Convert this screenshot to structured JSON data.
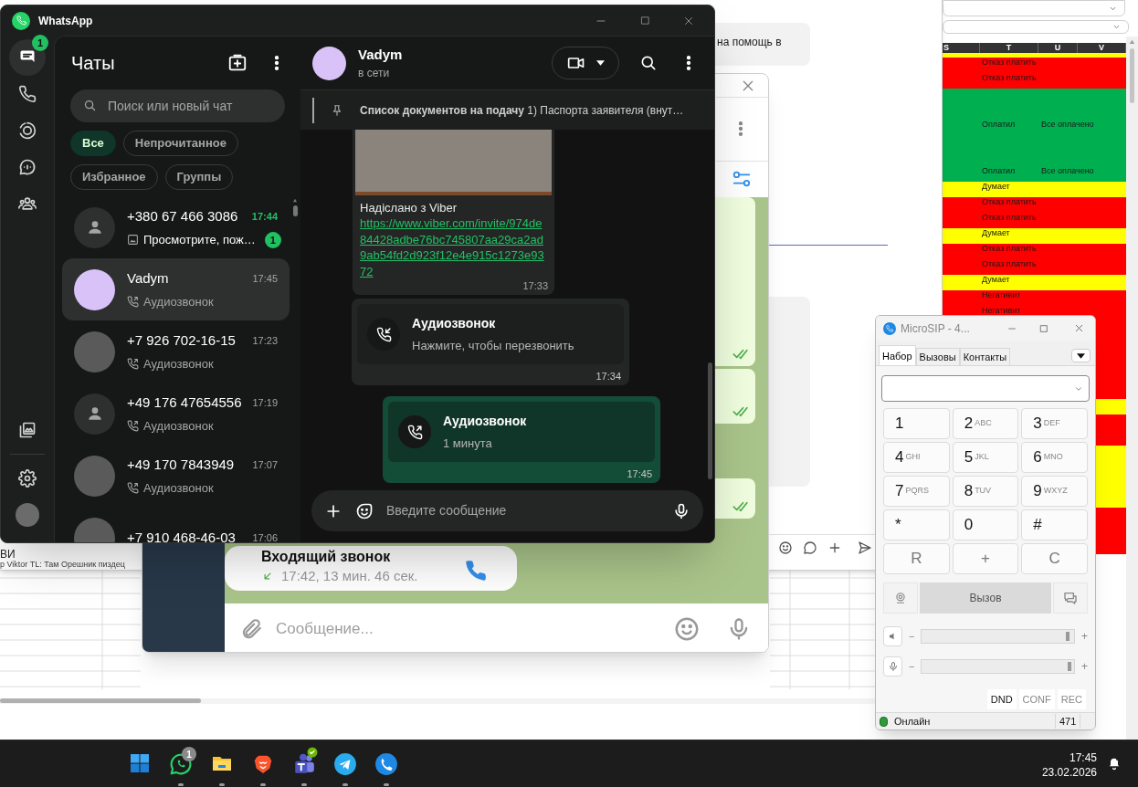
{
  "spreadsheet": {
    "columns": [
      "S",
      "T",
      "U",
      "V"
    ],
    "rows": [
      {
        "kind": "partial",
        "color": "#ffff00"
      },
      {
        "kind": "normal",
        "color": "#ff0000",
        "t": "Отказ платить"
      },
      {
        "kind": "normal",
        "color": "#ff0000",
        "t": "Отказ платить"
      },
      {
        "kind": "tall",
        "color": "#00b050",
        "t": "Оплатил",
        "u": "Все оплачено"
      },
      {
        "kind": "tall",
        "color": "#00b050",
        "t": "Оплатил",
        "u": "Все оплачено"
      },
      {
        "kind": "normal",
        "color": "#ffff00",
        "t": "Думает"
      },
      {
        "kind": "normal",
        "color": "#ff0000",
        "t": "Отказ платить"
      },
      {
        "kind": "normal",
        "color": "#ff0000",
        "t": "Отказ платить"
      },
      {
        "kind": "normal",
        "color": "#ffff00",
        "t": "Думает"
      },
      {
        "kind": "normal",
        "color": "#ff0000",
        "t": "Отказ платить"
      },
      {
        "kind": "normal",
        "color": "#ff0000",
        "t": "Отказ платить"
      },
      {
        "kind": "normal",
        "color": "#ffff00",
        "t": "Думает"
      },
      {
        "kind": "normal",
        "color": "#ff0000",
        "t": "Негативит"
      },
      {
        "kind": "normal",
        "color": "#ff0000",
        "t": "Негативит"
      },
      {
        "kind": "normal",
        "color": "#ff0000"
      },
      {
        "kind": "normal",
        "color": "#ff0000"
      },
      {
        "kind": "normal",
        "color": "#ff0000"
      },
      {
        "kind": "normal",
        "color": "#ff0000"
      },
      {
        "kind": "normal",
        "color": "#ff0000"
      },
      {
        "kind": "normal",
        "color": "#ffff00"
      },
      {
        "kind": "normal",
        "color": "#ff0000"
      },
      {
        "kind": "normal",
        "color": "#ff0000"
      },
      {
        "kind": "normal",
        "color": "#ffff00"
      },
      {
        "kind": "normal",
        "color": "#ffff00"
      },
      {
        "kind": "normal",
        "color": "#ffff00"
      },
      {
        "kind": "normal",
        "color": "#ffff00"
      },
      {
        "kind": "normal",
        "color": "#ff0000"
      },
      {
        "kind": "normal",
        "color": "#ff0000"
      },
      {
        "kind": "normal",
        "color": "#ff0000"
      }
    ]
  },
  "browser": {
    "snippet": "на помощь в",
    "footer_title": "ВИ",
    "footer_preview": "р Viktor TL: Там Орешник пиздец"
  },
  "telegram": {
    "call_bubble": {
      "title": "Входящий звонок",
      "detail": "17:42, 13 мин. 46 сек."
    },
    "input_placeholder": "Сообщение..."
  },
  "whatsapp": {
    "title": "WhatsApp",
    "rail": {
      "top": [
        {
          "kind": "chats",
          "selected": true,
          "badge": "1"
        },
        {
          "kind": "calls",
          "selected": false
        },
        {
          "kind": "status",
          "selected": false
        },
        {
          "kind": "channels",
          "selected": false
        },
        {
          "kind": "communities",
          "selected": false
        }
      ],
      "bottom": [
        {
          "kind": "media",
          "selected": false
        },
        {
          "kind": "settings",
          "selected": false
        },
        {
          "kind": "profile",
          "selected": false
        }
      ]
    },
    "chats_title": "Чаты",
    "search_placeholder": "Поиск или новый чат",
    "filters": [
      {
        "label": "Все",
        "selected": true
      },
      {
        "label": "Непрочитанное",
        "selected": false
      },
      {
        "label": "Избранное",
        "selected": false
      },
      {
        "label": "Группы",
        "selected": false
      }
    ],
    "chats": [
      {
        "name": "+380 67 466 3086",
        "time": "17:44",
        "preview": {
          "kind": "image",
          "text": "Просмотрите, пож…"
        },
        "unread": "1",
        "avatar": {
          "kind": "default"
        },
        "selected": false
      },
      {
        "name": "Vadym",
        "time": "17:45",
        "preview": {
          "kind": "call",
          "text": "Аудиозвонок"
        },
        "avatar": {
          "kind": "illustration"
        },
        "selected": true
      },
      {
        "name": "+7 926 702-16-15",
        "time": "17:23",
        "preview": {
          "kind": "call",
          "text": "Аудиозвонок"
        },
        "avatar": {
          "kind": "photo"
        },
        "selected": false
      },
      {
        "name": "+49 176 47654556",
        "time": "17:19",
        "preview": {
          "kind": "call",
          "text": "Аудиозвонок"
        },
        "avatar": {
          "kind": "default"
        },
        "selected": false
      },
      {
        "name": "+49 170 7843949",
        "time": "17:07",
        "preview": {
          "kind": "call",
          "text": "Аудиозвонок"
        },
        "avatar": {
          "kind": "photo"
        },
        "selected": false
      },
      {
        "name": "+7 910 468-46-03",
        "time": "17:06",
        "avatar": {
          "kind": "photo"
        },
        "selected": false
      }
    ],
    "conversation": {
      "name": "Vadym",
      "status": "в сети",
      "pinned": "**Список документов на подачу** 1) Паспорта заявителя (внут…",
      "messages": [
        {
          "kind": "media",
          "outgoing": false,
          "caption": "Надіслано з Viber",
          "link": "https://www.viber.com/invite/974de84428adbe76bc745807aa29ca2ad9ab54fd2d923f12e4e915c1273e9372",
          "time": "17:33"
        },
        {
          "kind": "call",
          "outgoing": false,
          "title": "Аудиозвонок",
          "subtitle": "Нажмите, чтобы перезвонить",
          "time": "17:34"
        },
        {
          "kind": "call",
          "outgoing": true,
          "title": "Аудиозвонок",
          "subtitle": "1 минута",
          "time": "17:45"
        }
      ],
      "input_placeholder": "Введите сообщение"
    }
  },
  "microsip": {
    "title": "MicroSIP - 4...",
    "tabs": [
      {
        "label": "Набор",
        "selected": true
      },
      {
        "label": "Вызовы",
        "selected": false
      },
      {
        "label": "Контакты",
        "selected": false
      }
    ],
    "keys": [
      {
        "main": "1"
      },
      {
        "main": "2",
        "sub": "ABC"
      },
      {
        "main": "3",
        "sub": "DEF"
      },
      {
        "main": "4",
        "sub": "GHI"
      },
      {
        "main": "5",
        "sub": "JKL"
      },
      {
        "main": "6",
        "sub": "MNO"
      },
      {
        "main": "7",
        "sub": "PQRS"
      },
      {
        "main": "8",
        "sub": "TUV"
      },
      {
        "main": "9",
        "sub": "WXYZ"
      },
      {
        "main": "*"
      },
      {
        "main": "0"
      },
      {
        "main": "#"
      }
    ],
    "actions": [
      "R",
      "+",
      "C"
    ],
    "call_button": "Вызов",
    "sliders": [
      {
        "kind": "speaker",
        "minus": "−",
        "plus": "+",
        "level": 0.97
      },
      {
        "kind": "microphone",
        "minus": "−",
        "plus": "+",
        "level": 0.98
      }
    ],
    "toggles": [
      {
        "label": "DND",
        "disabled": false
      },
      {
        "label": "CONF",
        "disabled": true
      },
      {
        "label": "REC",
        "disabled": true
      }
    ],
    "status": "Онлайн",
    "extension": "471"
  },
  "taskbar": {
    "apps": [
      {
        "kind": "start",
        "running": false
      },
      {
        "kind": "whatsapp",
        "running": true,
        "badge": "1"
      },
      {
        "kind": "explorer",
        "running": true
      },
      {
        "kind": "brave",
        "running": true
      },
      {
        "kind": "teams",
        "running": true
      },
      {
        "kind": "telegram",
        "running": true
      },
      {
        "kind": "microsip",
        "running": true
      }
    ],
    "time": "17:45",
    "date": "23.02.2026"
  }
}
